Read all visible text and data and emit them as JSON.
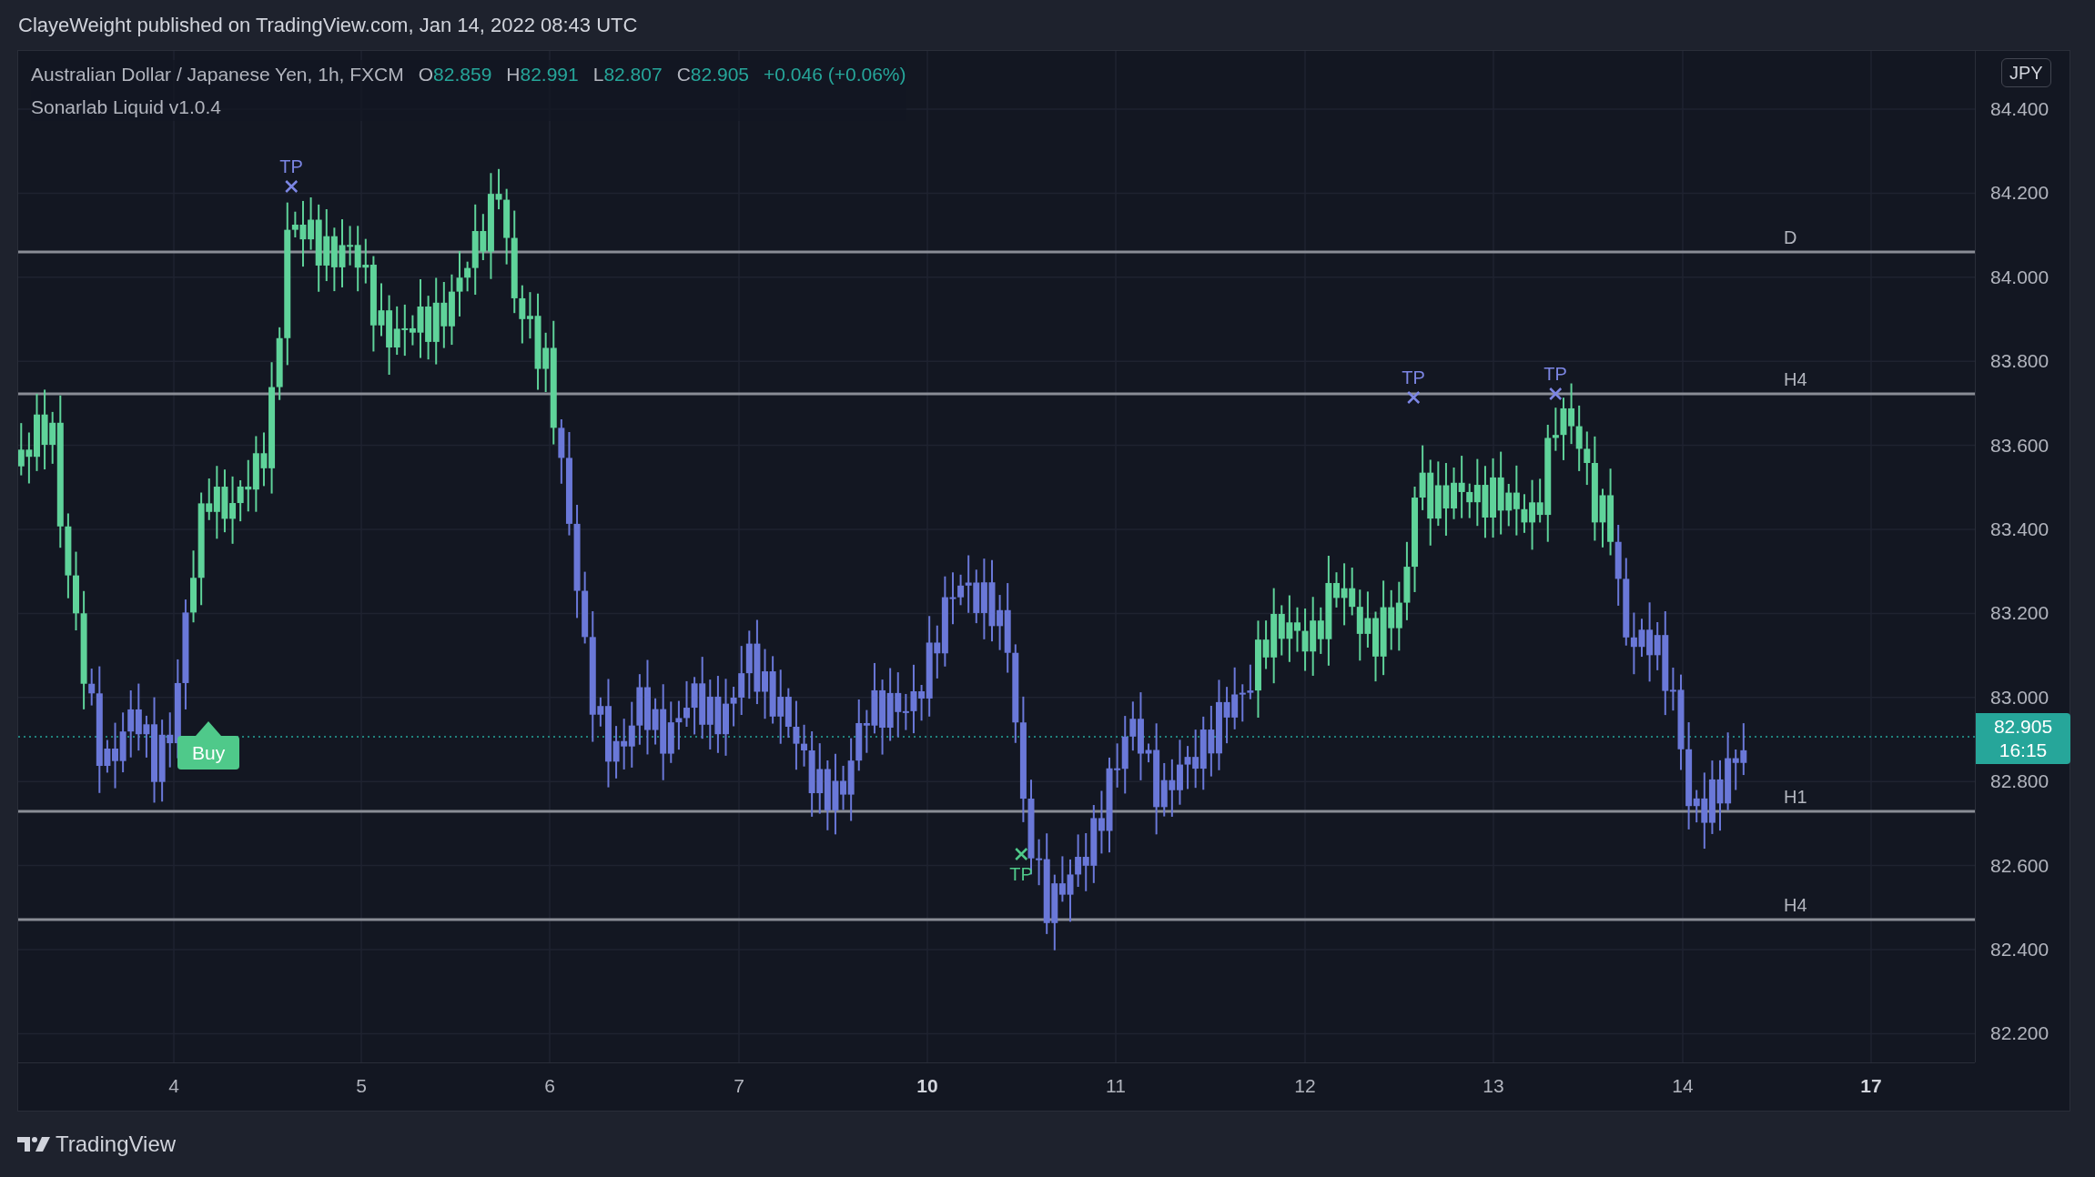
{
  "header": {
    "publisher_line": "ClayeWeight published on TradingView.com, Jan 14, 2022 08:43 UTC"
  },
  "legend": {
    "symbol": "Australian Dollar / Japanese Yen, 1h, FXCM",
    "ohlc": [
      {
        "label": "O",
        "value": "82.859"
      },
      {
        "label": "H",
        "value": "82.991"
      },
      {
        "label": "L",
        "value": "82.807"
      },
      {
        "label": "C",
        "value": "82.905"
      }
    ],
    "change": "+0.046 (+0.06%)",
    "indicator": "Sonarlab Liquid v1.0.4"
  },
  "currency_badge": "JPY",
  "price_axis": [
    "84.400",
    "84.200",
    "84.000",
    "83.800",
    "83.600",
    "83.400",
    "83.200",
    "83.000",
    "82.800",
    "82.600",
    "82.400",
    "82.200"
  ],
  "time_axis": [
    {
      "label": "4",
      "bold": false
    },
    {
      "label": "5",
      "bold": false
    },
    {
      "label": "6",
      "bold": false
    },
    {
      "label": "7",
      "bold": false
    },
    {
      "label": "10",
      "bold": true
    },
    {
      "label": "11",
      "bold": false
    },
    {
      "label": "12",
      "bold": false
    },
    {
      "label": "13",
      "bold": false
    },
    {
      "label": "14",
      "bold": false
    },
    {
      "label": "17",
      "bold": true
    }
  ],
  "levels": [
    {
      "label": "D"
    },
    {
      "label": "H4"
    },
    {
      "label": "H1"
    },
    {
      "label": "H4"
    }
  ],
  "markers": [
    {
      "kind": "tp_above",
      "label": "TP",
      "color": "#7c86e4"
    },
    {
      "kind": "tp_above",
      "label": "TP",
      "color": "#7c86e4"
    },
    {
      "kind": "tp_above",
      "label": "TP",
      "color": "#7c86e4"
    },
    {
      "kind": "tp_below",
      "label": "TP",
      "color": "#4fc98a"
    }
  ],
  "signals": [
    {
      "label": "Buy"
    }
  ],
  "last_price": {
    "price": "82.905",
    "countdown": "16:15"
  },
  "footer": {
    "logo_text": "TradingView"
  }
}
